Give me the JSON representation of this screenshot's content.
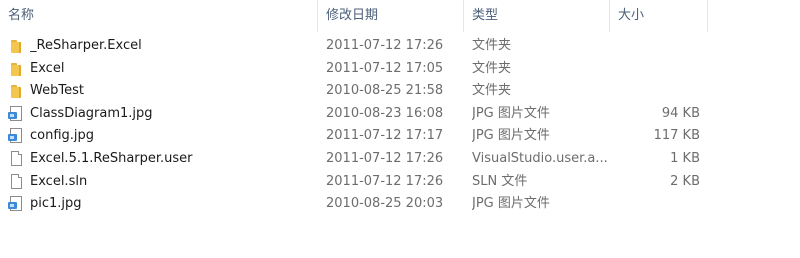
{
  "columns": {
    "name": "名称",
    "date": "修改日期",
    "type": "类型",
    "size": "大小"
  },
  "sort_indicator": "^",
  "files": [
    {
      "name": "_ReSharper.Excel",
      "date": "2011-07-12 17:26",
      "type": "文件夹",
      "size": "",
      "icon": "folder-icon"
    },
    {
      "name": "Excel",
      "date": "2011-07-12 17:05",
      "type": "文件夹",
      "size": "",
      "icon": "folder-icon"
    },
    {
      "name": "WebTest",
      "date": "2010-08-25 21:58",
      "type": "文件夹",
      "size": "",
      "icon": "folder-icon"
    },
    {
      "name": "ClassDiagram1.jpg",
      "date": "2010-08-23 16:08",
      "type": "JPG 图片文件",
      "size": "94 KB",
      "icon": "image-file-icon"
    },
    {
      "name": "config.jpg",
      "date": "2011-07-12 17:17",
      "type": "JPG 图片文件",
      "size": "117 KB",
      "icon": "image-file-icon"
    },
    {
      "name": "Excel.5.1.ReSharper.user",
      "date": "2011-07-12 17:26",
      "type": "VisualStudio.user.a...",
      "size": "1 KB",
      "icon": "file-icon"
    },
    {
      "name": "Excel.sln",
      "date": "2011-07-12 17:26",
      "type": "SLN 文件",
      "size": "2 KB",
      "icon": "file-icon"
    },
    {
      "name": "pic1.jpg",
      "date": "2010-08-25 20:03",
      "type": "JPG 图片文件",
      "size": "",
      "icon": "image-file-icon"
    }
  ]
}
